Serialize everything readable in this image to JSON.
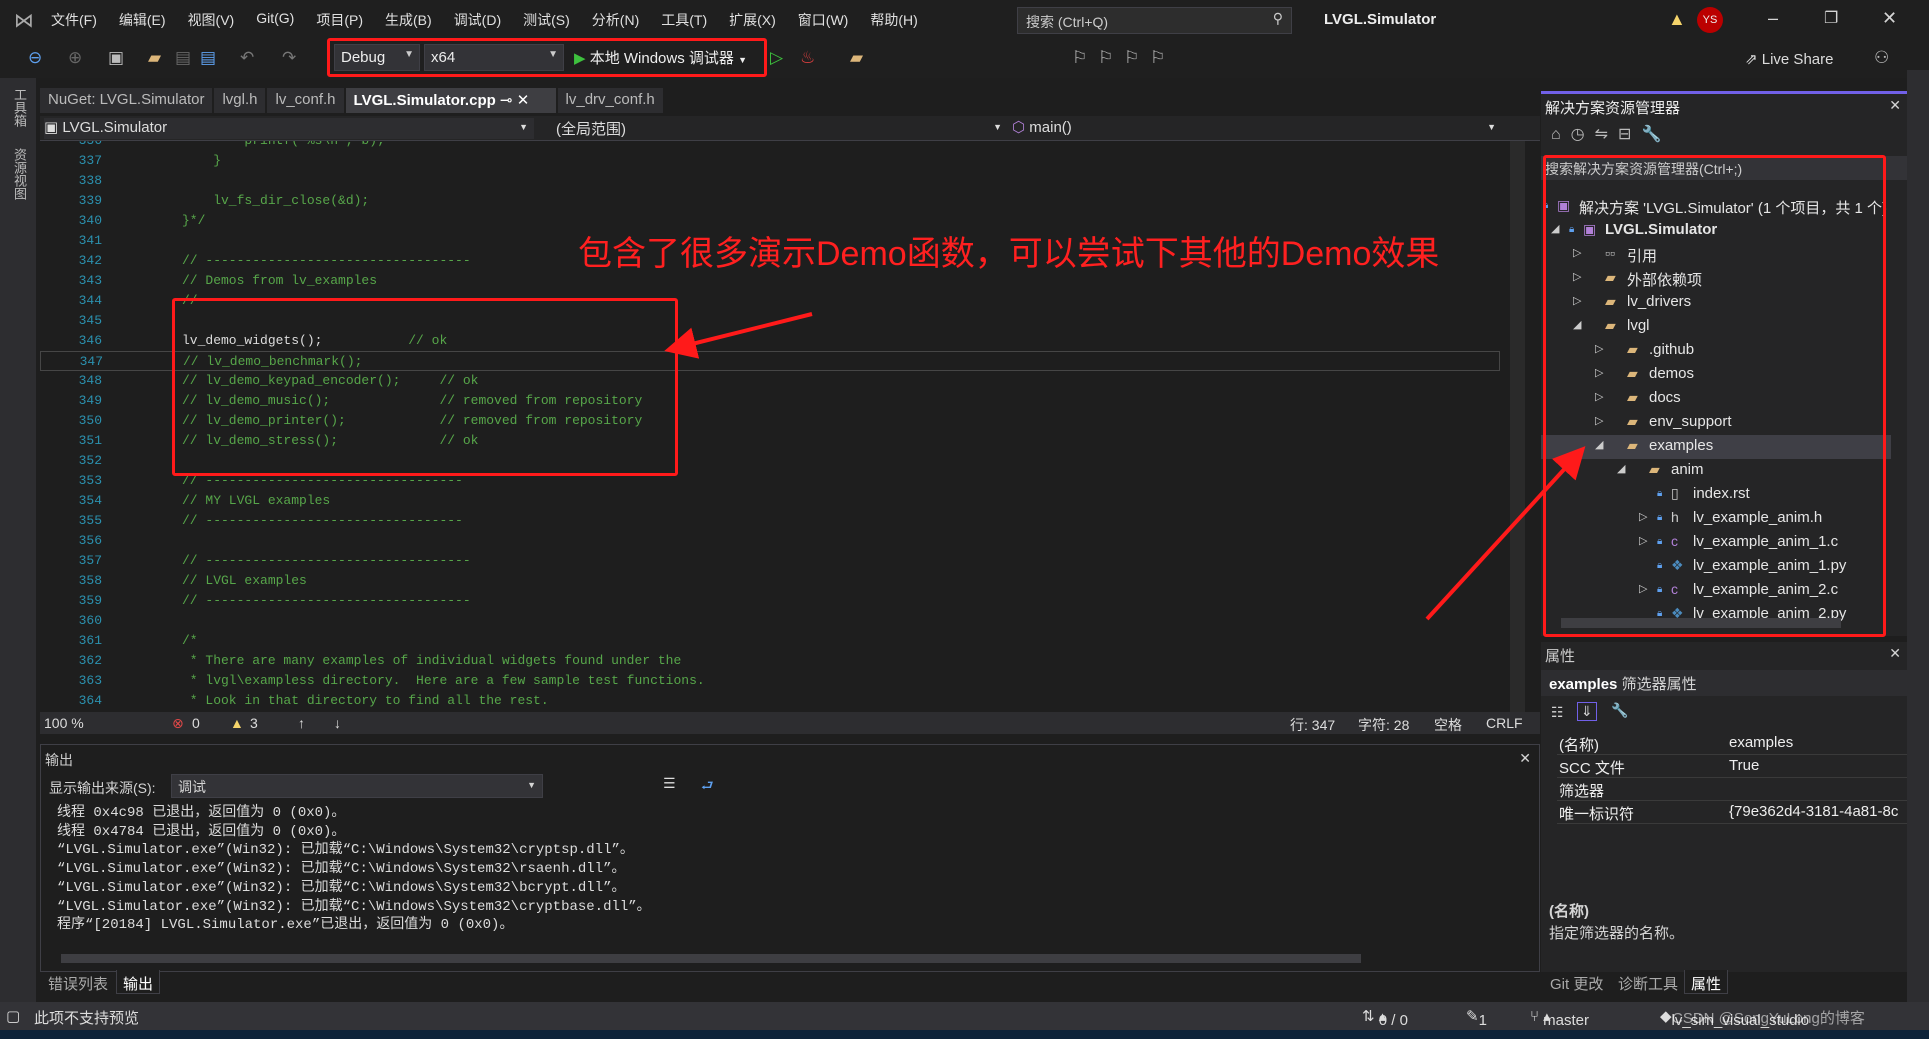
{
  "menu": [
    "文件(F)",
    "编辑(E)",
    "视图(V)",
    "Git(G)",
    "项目(P)",
    "生成(B)",
    "调试(D)",
    "测试(S)",
    "分析(N)",
    "工具(T)",
    "扩展(X)",
    "窗口(W)",
    "帮助(H)"
  ],
  "search_placeholder": "搜索 (Ctrl+Q)",
  "window_title": "LVGL.Simulator",
  "user_initials": "YS",
  "toolbar": {
    "config": "Debug",
    "platform": "x64",
    "run_label": "本地 Windows 调试器",
    "live_share": "Live Share"
  },
  "left_strip": [
    "工具箱",
    "资源视图"
  ],
  "tabs": [
    {
      "label": "NuGet: LVGL.Simulator"
    },
    {
      "label": "lvgl.h"
    },
    {
      "label": "lv_conf.h"
    },
    {
      "label": "LVGL.Simulator.cpp",
      "active": true
    },
    {
      "label": "lv_drv_conf.h"
    }
  ],
  "navbar": {
    "project": "LVGL.Simulator",
    "scope": "(全局范围)",
    "member": "main()"
  },
  "code_lines": [
    {
      "n": "336",
      "code": "",
      "comment": "        printf(\"%s\\n\", b);"
    },
    {
      "n": "337",
      "code": "",
      "comment": "    }"
    },
    {
      "n": "338",
      "code": "",
      "comment": ""
    },
    {
      "n": "339",
      "code": "",
      "comment": "    lv_fs_dir_close(&d);"
    },
    {
      "n": "340",
      "code": "",
      "comment": "}*/"
    },
    {
      "n": "341",
      "code": "",
      "comment": ""
    },
    {
      "n": "342",
      "code": "",
      "comment": "// ----------------------------------"
    },
    {
      "n": "343",
      "code": "",
      "comment": "// Demos from lv_examples"
    },
    {
      "n": "344",
      "code": "",
      "comment": "// ----------------------------------"
    },
    {
      "n": "345",
      "code": "",
      "comment": ""
    },
    {
      "n": "346",
      "code": "lv_demo_widgets();",
      "comment": "           // ok"
    },
    {
      "n": "347",
      "code": "",
      "comment": "// lv_demo_benchmark();"
    },
    {
      "n": "348",
      "code": "",
      "comment": "// lv_demo_keypad_encoder();     // ok"
    },
    {
      "n": "349",
      "code": "",
      "comment": "// lv_demo_music();              // removed from repository"
    },
    {
      "n": "350",
      "code": "",
      "comment": "// lv_demo_printer();            // removed from repository"
    },
    {
      "n": "351",
      "code": "",
      "comment": "// lv_demo_stress();             // ok"
    },
    {
      "n": "352",
      "code": "",
      "comment": ""
    },
    {
      "n": "353",
      "code": "",
      "comment": "// ---------------------------------"
    },
    {
      "n": "354",
      "code": "",
      "comment": "// MY LVGL examples"
    },
    {
      "n": "355",
      "code": "",
      "comment": "// ---------------------------------"
    },
    {
      "n": "356",
      "code": "",
      "comment": ""
    },
    {
      "n": "357",
      "code": "",
      "comment": "// ----------------------------------"
    },
    {
      "n": "358",
      "code": "",
      "comment": "// LVGL examples"
    },
    {
      "n": "359",
      "code": "",
      "comment": "// ----------------------------------"
    },
    {
      "n": "360",
      "code": "",
      "comment": ""
    },
    {
      "n": "361",
      "code": "",
      "comment": "/*"
    },
    {
      "n": "362",
      "code": "",
      "comment": " * There are many examples of individual widgets found under the"
    },
    {
      "n": "363",
      "code": "",
      "comment": " * lvgl\\exampless directory.  Here are a few sample test functions."
    },
    {
      "n": "364",
      "code": "",
      "comment": " * Look in that directory to find all the rest."
    }
  ],
  "editor_status": {
    "zoom": "100 %",
    "errors": "0",
    "warnings": "3",
    "line": "行: 347",
    "char": "字符: 28",
    "spaces": "空格",
    "eol": "CRLF"
  },
  "output": {
    "title": "输出",
    "source_label": "显示输出来源(S):",
    "source_value": "调试",
    "lines": [
      "线程 0x4c98 已退出，返回值为 0 (0x0)。",
      "线程 0x4784 已退出，返回值为 0 (0x0)。",
      "“LVGL.Simulator.exe”(Win32): 已加载“C:\\Windows\\System32\\cryptsp.dll”。",
      "“LVGL.Simulator.exe”(Win32): 已加载“C:\\Windows\\System32\\rsaenh.dll”。",
      "“LVGL.Simulator.exe”(Win32): 已加载“C:\\Windows\\System32\\bcrypt.dll”。",
      "“LVGL.Simulator.exe”(Win32): 已加载“C:\\Windows\\System32\\cryptbase.dll”。",
      "程序“[20184] LVGL.Simulator.exe”已退出，返回值为 0 (0x0)。"
    ]
  },
  "bottom_tabs": [
    "错误列表",
    "输出"
  ],
  "status": {
    "preview": "此项不支持预览",
    "sync": "0 / 0",
    "edits": "1",
    "branch": "master",
    "repo": "lv_sim_visual_studio",
    "watermark": "CSDN @SongYuLong的博客"
  },
  "solution_explorer": {
    "title": "解决方案资源管理器",
    "search": "搜索解决方案资源管理器(Ctrl+;)",
    "items": [
      {
        "label": "解决方案 'LVGL.Simulator' (1 个项目，共 1 个)",
        "level": 0,
        "icon": "solution-icon",
        "toggle": ""
      },
      {
        "label": "LVGL.Simulator",
        "level": 0,
        "icon": "project-icon",
        "toggle": "expanded",
        "bold": true
      },
      {
        "label": "引用",
        "level": 1,
        "icon": "references-icon",
        "toggle": "collapsed"
      },
      {
        "label": "外部依赖项",
        "level": 1,
        "icon": "external-deps-icon",
        "toggle": "collapsed"
      },
      {
        "label": "lv_drivers",
        "level": 1,
        "icon": "filter-folder-icon",
        "toggle": "collapsed"
      },
      {
        "label": "lvgl",
        "level": 1,
        "icon": "filter-folder-icon",
        "toggle": "expanded"
      },
      {
        "label": ".github",
        "level": 2,
        "icon": "filter-folder-icon",
        "toggle": "collapsed"
      },
      {
        "label": "demos",
        "level": 2,
        "icon": "filter-folder-icon",
        "toggle": "collapsed"
      },
      {
        "label": "docs",
        "level": 2,
        "icon": "filter-folder-icon",
        "toggle": "collapsed"
      },
      {
        "label": "env_support",
        "level": 2,
        "icon": "filter-folder-icon",
        "toggle": "collapsed"
      },
      {
        "label": "examples",
        "level": 2,
        "icon": "filter-folder-icon",
        "toggle": "expanded",
        "selected": true
      },
      {
        "label": "anim",
        "level": 3,
        "icon": "filter-folder-icon",
        "toggle": "expanded"
      },
      {
        "label": "index.rst",
        "level": 4,
        "icon": "file-icon",
        "toggle": ""
      },
      {
        "label": "lv_example_anim.h",
        "level": 4,
        "icon": "header-file-icon",
        "toggle": "collapsed"
      },
      {
        "label": "lv_example_anim_1.c",
        "level": 4,
        "icon": "c-file-icon",
        "toggle": "collapsed"
      },
      {
        "label": "lv_example_anim_1.py",
        "level": 4,
        "icon": "python-file-icon",
        "toggle": ""
      },
      {
        "label": "lv_example_anim_2.c",
        "level": 4,
        "icon": "c-file-icon",
        "toggle": "collapsed"
      },
      {
        "label": "lv_example_anim_2.py",
        "level": 4,
        "icon": "python-file-icon",
        "toggle": ""
      }
    ]
  },
  "properties": {
    "title": "属性",
    "object": "examples",
    "object_type": "筛选器属性",
    "rows": [
      {
        "name": "(名称)",
        "value": "examples"
      },
      {
        "name": "SCC 文件",
        "value": "True"
      },
      {
        "name": "筛选器",
        "value": ""
      },
      {
        "name": "唯一标识符",
        "value": "{79e362d4-3181-4a81-8c"
      }
    ],
    "desc_title": "(名称)",
    "desc_text": "指定筛选器的名称。",
    "tabs": [
      "Git 更改",
      "诊断工具",
      "属性"
    ]
  },
  "annotation": {
    "text": "包含了很多演示Demo函数，可以尝试下其他的Demo效果",
    "color": "#ff2020"
  },
  "colors": {
    "comment": "#57a64a",
    "line_number": "#2b91af",
    "accent": "#7160e8"
  }
}
